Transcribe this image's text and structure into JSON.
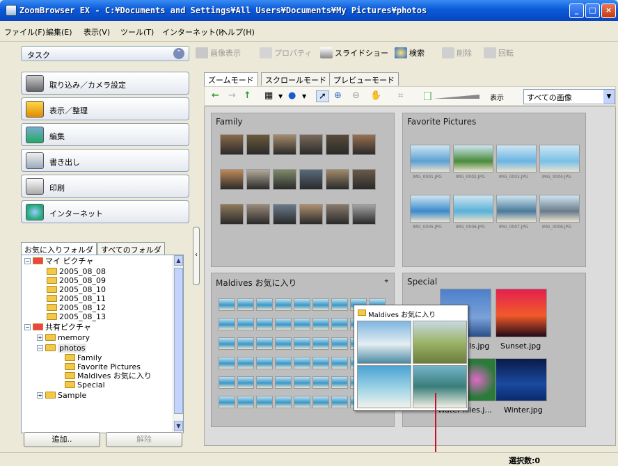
{
  "window": {
    "title": "ZoomBrowser EX  -  C:¥Documents and Settings¥All Users¥Documents¥My Pictures¥photos"
  },
  "menu": [
    "ファイル(F)",
    "編集(E)",
    "表示(V)",
    "ツール(T)",
    "インターネット(I)",
    "ヘルプ(H)"
  ],
  "sidebar": {
    "task_label": "タスク",
    "tasks": [
      "取り込み／カメラ設定",
      "表示／整理",
      "編集",
      "書き出し",
      "印刷",
      "インターネット"
    ],
    "folder_tabs": [
      "お気に入りフォルダ",
      "すべてのフォルダ"
    ],
    "tree": [
      {
        "label": "マイ ピクチャ",
        "level": 0
      },
      {
        "label": "2005_08_08",
        "level": 2
      },
      {
        "label": "2005_08_09",
        "level": 2
      },
      {
        "label": "2005_08_10",
        "level": 2
      },
      {
        "label": "2005_08_11",
        "level": 2
      },
      {
        "label": "2005_08_12",
        "level": 2
      },
      {
        "label": "2005_08_13",
        "level": 2
      },
      {
        "label": "共有ピクチャ",
        "level": 0
      },
      {
        "label": "memory",
        "level": 1
      },
      {
        "label": "photos",
        "level": 1
      },
      {
        "label": "Family",
        "level": 3
      },
      {
        "label": "Favorite Pictures",
        "level": 3
      },
      {
        "label": "Maldives お気に入り",
        "level": 3
      },
      {
        "label": "Special",
        "level": 3
      },
      {
        "label": "Sample",
        "level": 1
      }
    ],
    "add_button": "追加..",
    "remove_button": "解除"
  },
  "toolbar": {
    "view_image": "画像表示",
    "properties": "プロパティ",
    "slideshow": "スライドショー",
    "search": "検索",
    "delete": "削除",
    "rotate": "回転"
  },
  "view_tabs": [
    "ズームモード",
    "スクロールモード",
    "プレビューモード"
  ],
  "view_filter": {
    "label": "表示",
    "selected": "すべての画像"
  },
  "groups": {
    "family": {
      "title": "Family"
    },
    "favorites": {
      "title": "Favorite Pictures",
      "captions": [
        "IMG_0001.JPG",
        "IMG_0002.JPG",
        "IMG_0003.JPG",
        "IMG_0004.JPG",
        "IMG_0005.JPG",
        "IMG_0006.JPG",
        "IMG_0007.JPG",
        "IMG_0008.JPG"
      ]
    },
    "maldives": {
      "title": "Maldives お気に入り"
    },
    "special": {
      "title": "Special",
      "captions": [
        "hills.jpg",
        "Sunset.jpg",
        "Water lilies.j...",
        "Winter.jpg"
      ]
    }
  },
  "popup": {
    "title": "Maldives お気に入り"
  },
  "status": {
    "selection": "選択数:0"
  },
  "colors": {
    "titlebar": "#0a5ad8",
    "canvas": "#dcdcdc",
    "callout": "#c8102e"
  }
}
